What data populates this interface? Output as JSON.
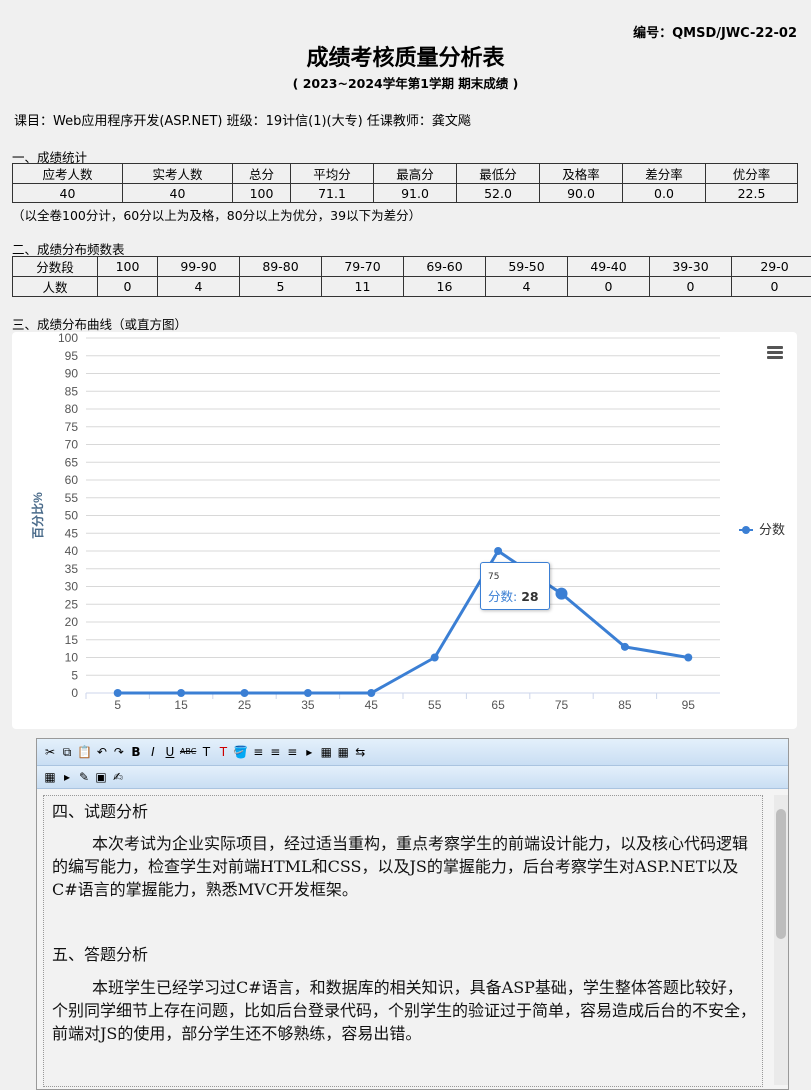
{
  "header": {
    "code": "编号：QMSD/JWC-22-02",
    "title": "成绩考核质量分析表",
    "subtitle": "( 2023~2024学年第1学期  期末成绩 )"
  },
  "course_line": "课目：Web应用程序开发(ASP.NET) 班级：19计信(1)(大专) 任课教师：龚文飚",
  "section1": {
    "title": "一、成绩统计",
    "headers": [
      "应考人数",
      "实考人数",
      "总分",
      "平均分",
      "最高分",
      "最低分",
      "及格率",
      "差分率",
      "优分率"
    ],
    "values": [
      "40",
      "40",
      "100",
      "71.1",
      "91.0",
      "52.0",
      "90.0",
      "0.0",
      "22.5"
    ],
    "note": "（以全卷100分计，60分以上为及格，80分以上为优分，39以下为差分）"
  },
  "section2": {
    "title": "二、成绩分布频数表",
    "headers": [
      "分数段",
      "100",
      "99-90",
      "89-80",
      "79-70",
      "69-60",
      "59-50",
      "49-40",
      "39-30",
      "29-0"
    ],
    "values": [
      "人数",
      "0",
      "4",
      "5",
      "11",
      "16",
      "4",
      "0",
      "0",
      "0"
    ]
  },
  "section3": {
    "title": "三、成绩分布曲线（或直方图）"
  },
  "chart_data": {
    "type": "line",
    "ylabel": "百分比%",
    "x": [
      5,
      15,
      25,
      35,
      45,
      55,
      65,
      75,
      85,
      95
    ],
    "series": [
      {
        "name": "分数",
        "values": [
          0,
          0,
          0,
          0,
          0,
          10,
          40,
          28,
          13,
          10
        ]
      }
    ],
    "ylim": [
      0,
      100
    ],
    "yticks": [
      0,
      5,
      10,
      15,
      20,
      25,
      30,
      35,
      40,
      45,
      50,
      55,
      60,
      65,
      70,
      75,
      80,
      85,
      90,
      95,
      100
    ],
    "legend_position": "right",
    "color": "#3b7fd4",
    "grid": true,
    "tooltip": {
      "x_label": "75",
      "series": "分数",
      "value": "28"
    }
  },
  "editor": {
    "toolbar1": [
      "✂",
      "⧉",
      "📋",
      "↶",
      "↷",
      "B",
      "I",
      "U",
      "ABC",
      "T",
      "T",
      "🪣",
      "≡",
      "≡",
      "≡",
      "▸",
      "▦",
      "▦",
      "⇆"
    ],
    "toolbar2": [
      "▦",
      "▸",
      "✎",
      "▣",
      "✍"
    ],
    "section4_title": "四、试题分析",
    "section4_text": "本次考试为企业实际项目，经过适当重构，重点考察学生的前端设计能力，以及核心代码逻辑的编写能力，检查学生对前端HTML和CSS，以及JS的掌握能力，后台考察学生对ASP.NET以及C#语言的掌握能力，熟悉MVC开发框架。",
    "section5_title": "五、答题分析",
    "section5_text": "本班学生已经学习过C#语言，和数据库的相关知识，具备ASP基础，学生整体答题比较好，个别同学细节上存在问题，比如后台登录代码，个别学生的验证过于简单，容易造成后台的不安全，前端对JS的使用，部分学生还不够熟练，容易出错。"
  }
}
